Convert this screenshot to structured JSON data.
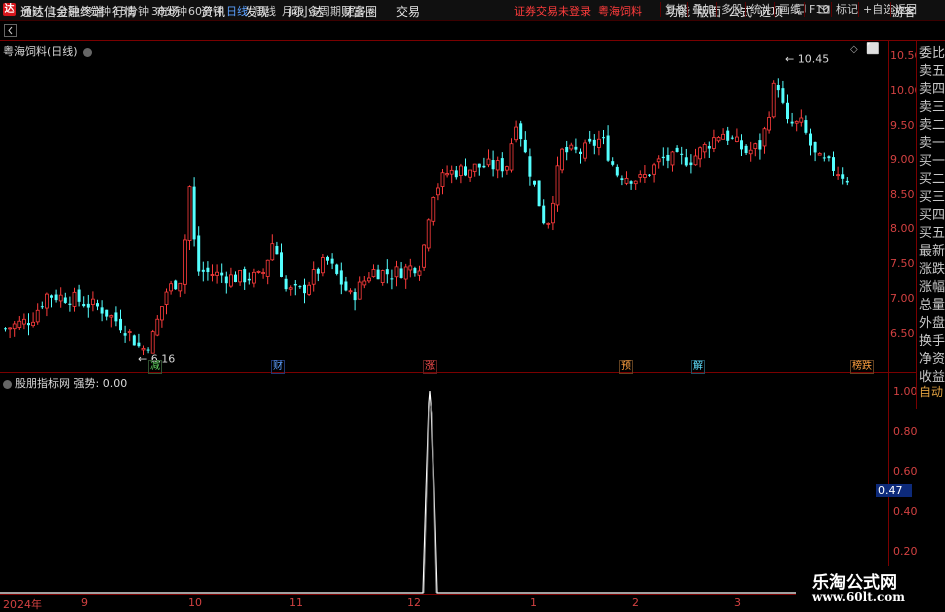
{
  "app": {
    "title": "通达信金融终端",
    "icon_glyph": "达"
  },
  "menus": [
    "行情",
    "市场",
    "资讯",
    "发现",
    "问小达",
    "财富圈",
    "交易"
  ],
  "notice": {
    "text": "证券交易未登录",
    "stock": "粤海饲料"
  },
  "right_menus": [
    "功能",
    "版面",
    "公式",
    "选项"
  ],
  "guest": "游客",
  "periods": [
    "分时",
    "1分钟",
    "5分钟",
    "15分钟",
    "30分钟",
    "60分钟",
    "日线",
    "周线",
    "月线",
    "多周期",
    "更多"
  ],
  "active_period": "日线",
  "tools": [
    "复权",
    "叠加",
    "多股",
    "统计",
    "画线",
    "F10",
    "+自选",
    "返回"
  ],
  "stock_label": "粤海饲料(日线)",
  "indicator_label": "股朋指标网 强势: 0.00",
  "side_panel": [
    "委比",
    "卖五",
    "卖四",
    "卖三",
    "卖二",
    "卖一",
    "买一",
    "买二",
    "买三",
    "买四",
    "买五",
    "最新",
    "涨跌",
    "涨幅",
    "总量",
    "外盘",
    "换手",
    "净资",
    "收益"
  ],
  "auto_button": "自动",
  "price_axis": [
    "10.50",
    "10.00",
    "9.50",
    "9.00",
    "8.50",
    "8.00",
    "7.50",
    "7.00",
    "6.50"
  ],
  "indicator_axis": [
    "1.00",
    "0.80",
    "0.60",
    "0.40",
    "0.20"
  ],
  "cursor_value": "0.47",
  "x_axis": [
    "2024年",
    "9",
    "10",
    "11",
    "12",
    "1",
    "2",
    "3"
  ],
  "high_marker": "10.45",
  "low_marker": "6.16",
  "event_tags": [
    "减",
    "财",
    "涨",
    "预",
    "解",
    "榜跌"
  ],
  "watermark": {
    "line1": "乐淘公式网",
    "line2": "www.60lt.com"
  },
  "colors": {
    "up": "#ff3c3c",
    "down": "#54ffff",
    "axis": "#d24141",
    "frame": "#7a0000"
  },
  "chart_data": {
    "type": "candlestick",
    "price_range": [
      6.16,
      10.45
    ],
    "indicator": {
      "name": "强势",
      "value": "0.00",
      "range": [
        0,
        1.0
      ],
      "spike_value": 1.0
    }
  }
}
